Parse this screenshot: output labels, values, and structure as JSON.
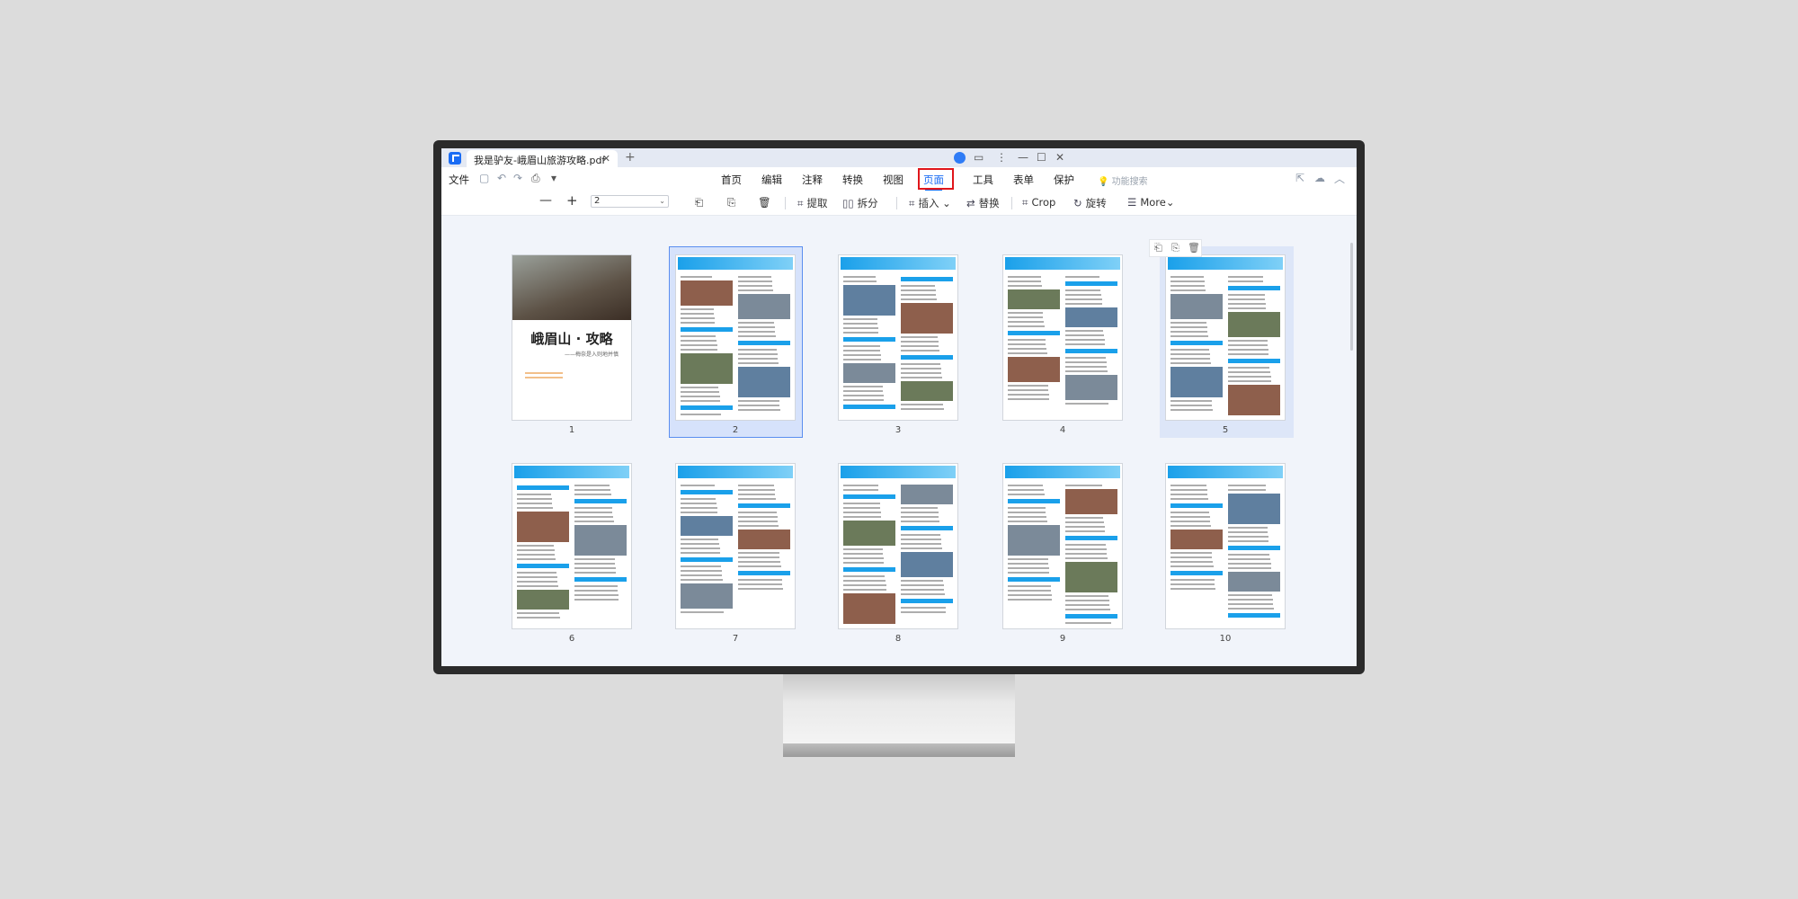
{
  "window": {
    "tab_title": "我是驴友-峨眉山旅游攻略.pdf",
    "file_menu": "文件",
    "search_label": "功能搜索"
  },
  "menu": [
    {
      "label": "首页"
    },
    {
      "label": "编辑"
    },
    {
      "label": "注释"
    },
    {
      "label": "转换"
    },
    {
      "label": "视图"
    },
    {
      "label": "页面",
      "active": true
    },
    {
      "label": "工具"
    },
    {
      "label": "表单"
    },
    {
      "label": "保护"
    }
  ],
  "toolbar": {
    "page_select_value": "2",
    "extract": "提取",
    "split": "拆分",
    "insert": "插入",
    "replace": "替换",
    "crop": "Crop",
    "rotate": "旋转",
    "more": "More"
  },
  "pages": [
    {
      "num": "1",
      "cover_title": "峨眉山 · 攻略",
      "cover_subtitle": "——梅奈是入则地并慎"
    },
    {
      "num": "2",
      "selected": true
    },
    {
      "num": "3"
    },
    {
      "num": "4"
    },
    {
      "num": "5",
      "hovered": true
    },
    {
      "num": "6"
    },
    {
      "num": "7"
    },
    {
      "num": "8"
    },
    {
      "num": "9"
    },
    {
      "num": "10"
    }
  ],
  "colors": {
    "accent": "#1a6cf4",
    "highlight_box": "#e0161b",
    "page_header": "#1aa0ea"
  }
}
